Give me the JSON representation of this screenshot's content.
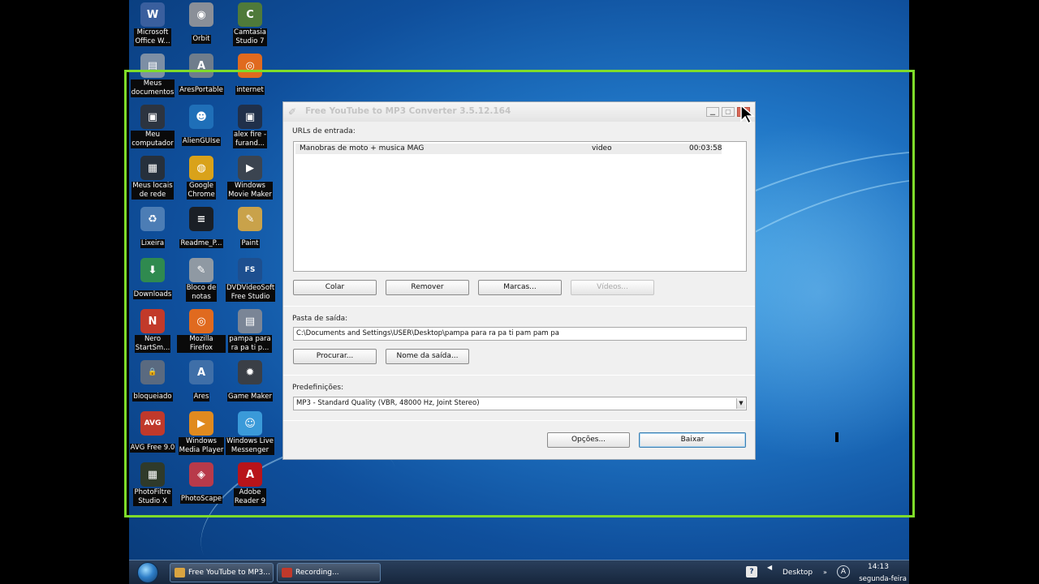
{
  "desktop": {
    "icons": [
      {
        "label": "Microsoft\nOffice W...",
        "icon": "office-icon",
        "color": "#3a5f9e",
        "glyph": "W"
      },
      {
        "label": "Orbit",
        "icon": "orbit-icon",
        "color": "#8a8f98",
        "glyph": "◉"
      },
      {
        "label": "Camtasia\nStudio 7",
        "icon": "camtasia-icon",
        "color": "#4f7a3a",
        "glyph": "C"
      },
      {
        "label": "Meus\ndocumentos",
        "icon": "folder-documents-icon",
        "color": "#7d8fa5",
        "glyph": "▤"
      },
      {
        "label": "AresPortable",
        "icon": "ares-portable-icon",
        "color": "#6f7d8c",
        "glyph": "A"
      },
      {
        "label": "internet",
        "icon": "firefox-icon",
        "color": "#e06a1f",
        "glyph": "◎"
      },
      {
        "label": "Meu\ncomputador",
        "icon": "computer-icon",
        "color": "#2c3440",
        "glyph": "▣"
      },
      {
        "label": "AlienGUIse",
        "icon": "alienguise-icon",
        "color": "#1f6fb8",
        "glyph": "☻"
      },
      {
        "label": "alex fire -\nfurand...",
        "icon": "alex-fire-icon",
        "color": "#20304a",
        "glyph": "▣"
      },
      {
        "label": "Meus locais\nde rede",
        "icon": "network-places-icon",
        "color": "#26303c",
        "glyph": "▦"
      },
      {
        "label": "Google\nChrome",
        "icon": "chrome-icon",
        "color": "#d9a21a",
        "glyph": "◍"
      },
      {
        "label": "Windows\nMovie Maker",
        "icon": "movie-maker-icon",
        "color": "#3b4450",
        "glyph": "▶"
      },
      {
        "label": "Lixeira",
        "icon": "recycle-bin-icon",
        "color": "#4c7db5",
        "glyph": "♻"
      },
      {
        "label": "Readme_P...",
        "icon": "readme-icon",
        "color": "#1a1f26",
        "glyph": "≡"
      },
      {
        "label": "Paint",
        "icon": "paint-icon",
        "color": "#c9a24a",
        "glyph": "✎"
      },
      {
        "label": "Downloads",
        "icon": "downloads-icon",
        "color": "#2f8a4f",
        "glyph": "⬇"
      },
      {
        "label": "Bloco de\nnotas",
        "icon": "notepad-icon",
        "color": "#8f99a3",
        "glyph": "✎"
      },
      {
        "label": "DVDVideoSoft\nFree Studio",
        "icon": "free-studio-icon",
        "color": "#1d4f8f",
        "glyph": "FS"
      },
      {
        "label": "Nero\nStartSm...",
        "icon": "nero-icon",
        "color": "#c23a2a",
        "glyph": "N"
      },
      {
        "label": "Mozilla Firefox",
        "icon": "firefox-icon",
        "color": "#e06a1f",
        "glyph": "◎"
      },
      {
        "label": "pampa para\nra pa ti p...",
        "icon": "file-icon",
        "color": "#7a8596",
        "glyph": "▤"
      },
      {
        "label": "bloqueiado",
        "icon": "lock-icon",
        "color": "#5a6a80",
        "glyph": "🔒"
      },
      {
        "label": "Ares",
        "icon": "ares-icon",
        "color": "#3f6fa8",
        "glyph": "A"
      },
      {
        "label": "Game Maker",
        "icon": "game-maker-icon",
        "color": "#3a3f46",
        "glyph": "✹"
      },
      {
        "label": "AVG Free 9.0",
        "icon": "avg-icon",
        "color": "#c0392b",
        "glyph": "AVG"
      },
      {
        "label": "Windows\nMedia Player",
        "icon": "media-player-icon",
        "color": "#e08a1f",
        "glyph": "▶"
      },
      {
        "label": "Windows Live\nMessenger",
        "icon": "messenger-icon",
        "color": "#3a9ad9",
        "glyph": "☺"
      },
      {
        "label": "PhotoFiltre\nStudio X",
        "icon": "photofiltre-icon",
        "color": "#2f3a2a",
        "glyph": "▦"
      },
      {
        "label": "PhotoScape",
        "icon": "photoscape-icon",
        "color": "#b83a4a",
        "glyph": "◈"
      },
      {
        "label": "Adobe\nReader 9",
        "icon": "adobe-reader-icon",
        "color": "#b8141a",
        "glyph": "A"
      }
    ]
  },
  "app": {
    "title": "Free YouTube to MP3 Converter 3.5.12.164",
    "urls_label": "URLs de entrada:",
    "url_rows": [
      {
        "name": "Manobras de moto + musica MAG",
        "type": "video",
        "duration": "00:03:58"
      }
    ],
    "buttons": {
      "paste": "Colar",
      "remove": "Remover",
      "marks": "Marcas...",
      "videos": "Vídeos...",
      "browse": "Procurar...",
      "output_name": "Nome da saída...",
      "options": "Opções...",
      "download": "Baixar"
    },
    "output_label": "Pasta de saída:",
    "output_path": "C:\\Documents and Settings\\USER\\Desktop\\pampa para ra pa ti pam pam pa",
    "presets_label": "Predefinições:",
    "preset_value": "MP3 - Standard Quality (VBR, 48000 Hz, Joint Stereo)"
  },
  "taskbar": {
    "tasks": [
      {
        "label": "Free YouTube to MP3...",
        "icon": "app-icon",
        "color": "#d9a441"
      },
      {
        "label": "Recording...",
        "icon": "recording-icon",
        "color": "#c0392b"
      }
    ],
    "desktop_label": "Desktop",
    "time": "14:13",
    "day": "segunda-feira"
  },
  "colors": {
    "recording_frame": "#7fdc2a",
    "desktop_blue": "#1f74c4"
  }
}
